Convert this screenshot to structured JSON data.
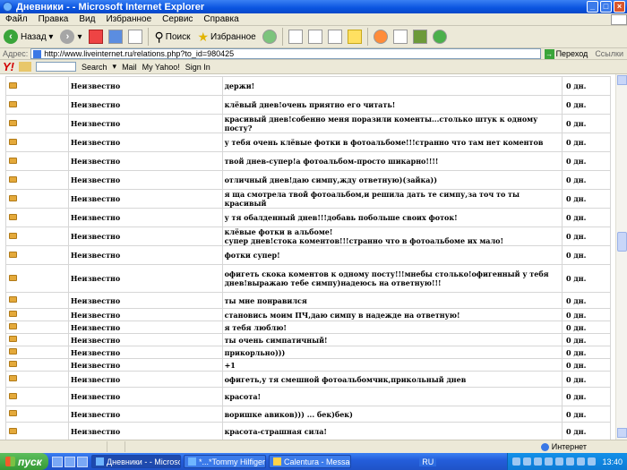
{
  "window": {
    "title": "Дневники - - Microsoft Internet Explorer",
    "btn_min": "_",
    "btn_max": "□",
    "btn_close": "×"
  },
  "menu": [
    "Файл",
    "Правка",
    "Вид",
    "Избранное",
    "Сервис",
    "Справка"
  ],
  "toolbar": {
    "back": "Назад",
    "search": "Поиск",
    "favorites": "Избранное"
  },
  "address": {
    "label": "Адрес:",
    "url": "http://www.liveinternet.ru/relations.php?to_id=980425",
    "go": "Переход",
    "links": "Ссылки"
  },
  "yahoo": {
    "logo": "Y!",
    "search": "Search",
    "mail": "Mail",
    "my_yahoo": "My Yahoo!",
    "signin": "Sign In"
  },
  "rows": [
    {
      "name": "Неизвестно",
      "text": "держи!",
      "date": "0 дн."
    },
    {
      "name": "Неизвестно",
      "text": "клёвый днев!очень приятно его читать!",
      "date": "0 дн."
    },
    {
      "name": "Неизвестно",
      "text": "красивый днев!собенно меня поразили коменты...столько штук к одному посту?",
      "date": "0 дн."
    },
    {
      "name": "Неизвестно",
      "text": "у тебя очень клёвые фотки в фотоальбоме!!!странно что там нет коментов",
      "date": "0 дн."
    },
    {
      "name": "Неизвестно",
      "text": "твой днев-супер!а фотоальбом-просто шикарно!!!!",
      "date": "0 дн."
    },
    {
      "name": "Неизвестно",
      "text": "отличный днев!даю симпу,жду ответную)(зайка))",
      "date": "0 дн."
    },
    {
      "name": "Неизвестно",
      "text": "я ща смотрела твой фотоальбом,и решила дать те симпу,за точ то ты красивый",
      "date": "0 дн."
    },
    {
      "name": "Неизвестно",
      "text": "у тя обалденный днев!!!добавь побольше своих фоток!",
      "date": "0 дн."
    },
    {
      "name": "Неизвестно",
      "text": "клёвые фотки в альбоме!\nсупер днев!стока коментов!!!странно что в фотоальбоме их мало!",
      "date": "0 дн."
    },
    {
      "name": "Неизвестно",
      "text": "фотки супер!",
      "date": "0 дн."
    },
    {
      "name": "Неизвестно",
      "text": "офигеть скока коментов к одному посту!!!мнебы столько!офигенный у тебя днев!выражаю тебе симпу)надеюсь на ответную!!!",
      "date": "0 дн."
    },
    {
      "name": "Неизвестно",
      "text": "ты мне понравился",
      "date": "0 дн."
    },
    {
      "name": "Неизвестно",
      "text": "становись моим ПЧ,даю симпу в надежде на ответную!",
      "date": "0 дн."
    },
    {
      "name": "Неизвестно",
      "text": "я тебя люблю!",
      "date": "0 дн."
    },
    {
      "name": "Неизвестно",
      "text": "ты очень симпатичный!",
      "date": "0 дн."
    },
    {
      "name": "Неизвестно",
      "text": "прикорльно)))",
      "date": "0 дн."
    },
    {
      "name": "Неизвестно",
      "text": "+1",
      "date": "0 дн."
    },
    {
      "name": "Неизвестно",
      "text": "офигеть,у тя смешной фотоальбомчик,прикольный днев",
      "date": "0 дн."
    },
    {
      "name": "Неизвестно",
      "text": "красота!",
      "date": "0 дн."
    },
    {
      "name": "Неизвестно",
      "text": "воришке авиков))) ... бек)бек)",
      "date": "0 дн."
    },
    {
      "name": "Неизвестно",
      "text": "красота-страшная сила!",
      "date": "0 дн."
    }
  ],
  "status": {
    "zone": "Интернет"
  },
  "taskbar": {
    "start": "пуск",
    "tasks": [
      "Дневники - - Microso...",
      "*...*Tommy Hilfiger*...",
      "Calentura - Message"
    ],
    "lang": "RU",
    "clock": "13:40"
  }
}
